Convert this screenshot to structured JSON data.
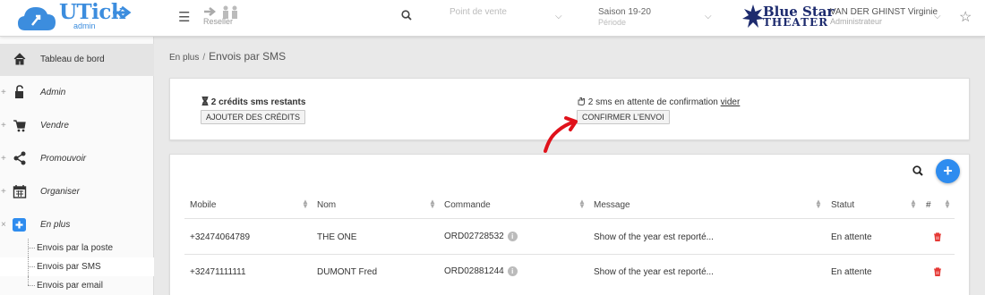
{
  "header": {
    "logo_text": "UTick",
    "logo_sub": "admin",
    "reseller_label": "Reseller",
    "point_de_vente": {
      "value": "Point de vente",
      "caption": ""
    },
    "saison": {
      "value": "Saison 19-20",
      "caption": "Période"
    },
    "brand": {
      "line1": "Blue Star",
      "line2": "THEATER"
    },
    "user": {
      "name": "VAN DER GHINST Virginie",
      "role": "Administrateur"
    }
  },
  "sidebar": {
    "items": [
      {
        "label": "Tableau de bord",
        "icon": "home-icon",
        "active": true
      },
      {
        "label": "Admin",
        "icon": "lock-icon"
      },
      {
        "label": "Vendre",
        "icon": "cart-icon"
      },
      {
        "label": "Promouvoir",
        "icon": "share-icon"
      },
      {
        "label": "Organiser",
        "icon": "calendar-icon"
      },
      {
        "label": "En plus",
        "icon": "plus-square-icon"
      }
    ],
    "sub_items": [
      {
        "label": "Envois par la poste"
      },
      {
        "label": "Envois par SMS",
        "active": true
      },
      {
        "label": "Envois par email"
      }
    ],
    "expanded_marker": "×",
    "collapsed_marker": "+"
  },
  "breadcrumb": {
    "parent": "En plus",
    "separator": "/",
    "current": "Envois par SMS"
  },
  "summary": {
    "credits_text": "2 crédits sms restants",
    "add_credits_button": "AJOUTER DES CRÉDITS",
    "pending_text": "2 sms en attente de confirmation",
    "clear_link": "vider",
    "confirm_button": "CONFIRMER L'ENVOI"
  },
  "table": {
    "columns": [
      "Mobile",
      "Nom",
      "Commande",
      "Message",
      "Statut",
      "#"
    ],
    "rows": [
      {
        "mobile": "+32474064789",
        "nom": "THE ONE",
        "commande": "ORD02728532",
        "message": "Show of the year est reporté...",
        "statut": "En attente"
      },
      {
        "mobile": "+32471111111",
        "nom": "DUMONT Fred",
        "commande": "ORD02881244",
        "message": "Show of the year est reporté...",
        "statut": "En attente"
      }
    ]
  },
  "colors": {
    "accent": "#2e8cef",
    "logo": "#3c8dde",
    "annotation": "#e0121b",
    "delete": "#e53935",
    "brand": "#1d2b6e"
  }
}
